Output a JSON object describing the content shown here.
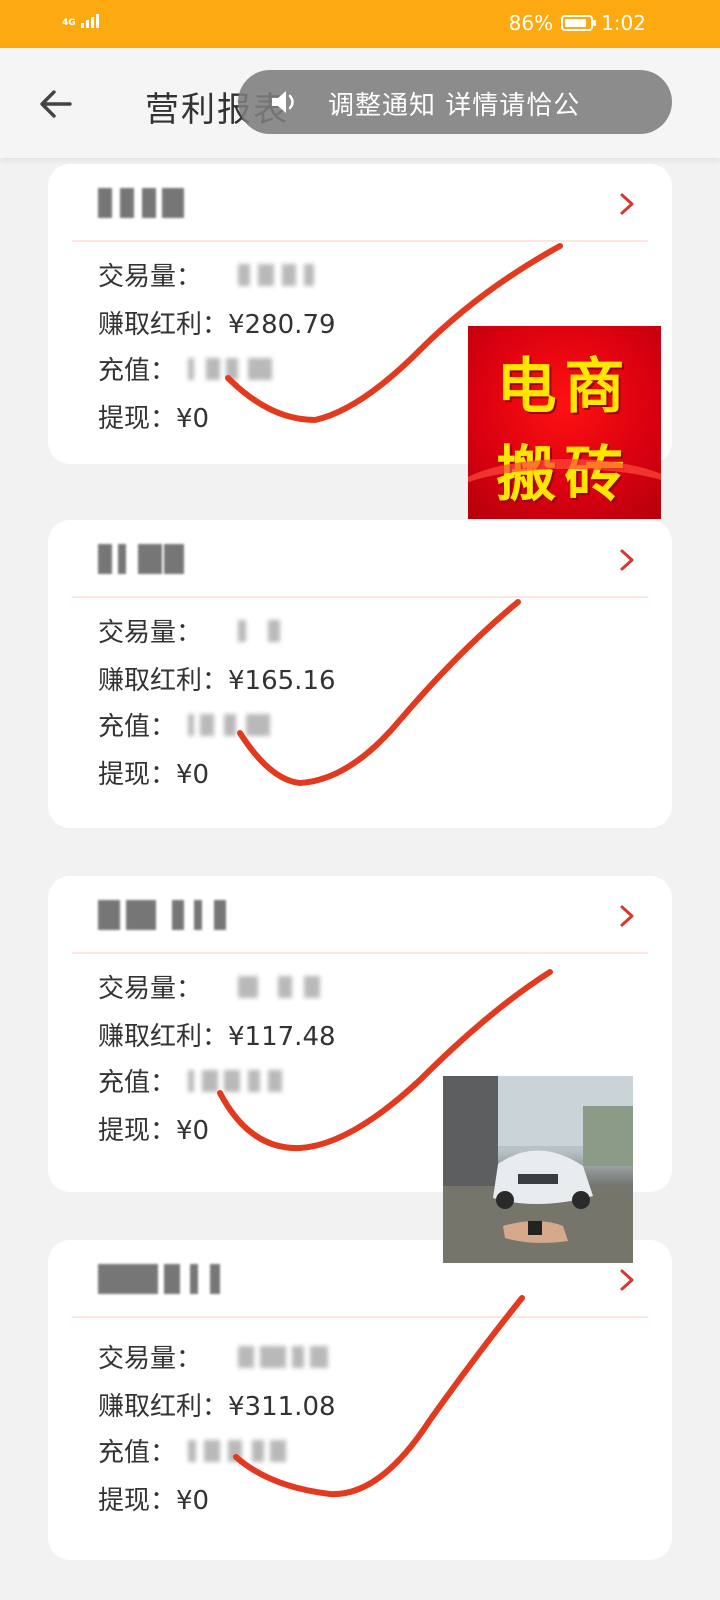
{
  "status_bar": {
    "network": "4G",
    "battery": "86%",
    "time": "1:02",
    "battery_level": 0.86,
    "background": "#fdaa12"
  },
  "header": {
    "title": "营利报表",
    "back_icon": "arrow-left-icon"
  },
  "notice": {
    "icon": "speaker-icon",
    "text": "调整通知 详情请恰公"
  },
  "accent_check_color": "#e23a1f",
  "cards": [
    {
      "rows": [
        {
          "label": "交易量：",
          "value": ""
        },
        {
          "label": "赚取红利：",
          "value": "¥280.79"
        },
        {
          "label": "充值：",
          "value": ""
        },
        {
          "label": "提现：",
          "value": "¥0"
        }
      ]
    },
    {
      "rows": [
        {
          "label": "交易量：",
          "value": ""
        },
        {
          "label": "赚取红利：",
          "value": "¥165.16"
        },
        {
          "label": "充值：",
          "value": ""
        },
        {
          "label": "提现：",
          "value": "¥0"
        }
      ]
    },
    {
      "rows": [
        {
          "label": "交易量：",
          "value": ""
        },
        {
          "label": "赚取红利：",
          "value": "¥117.48"
        },
        {
          "label": "充值：",
          "value": ""
        },
        {
          "label": "提现：",
          "value": "¥0"
        }
      ]
    },
    {
      "rows": [
        {
          "label": "交易量：",
          "value": ""
        },
        {
          "label": "赚取红利：",
          "value": "¥311.08"
        },
        {
          "label": "充值：",
          "value": ""
        },
        {
          "label": "提现：",
          "value": "¥0"
        }
      ]
    }
  ],
  "ads": {
    "banner_line1": "电商",
    "banner_line2": "搬砖"
  }
}
